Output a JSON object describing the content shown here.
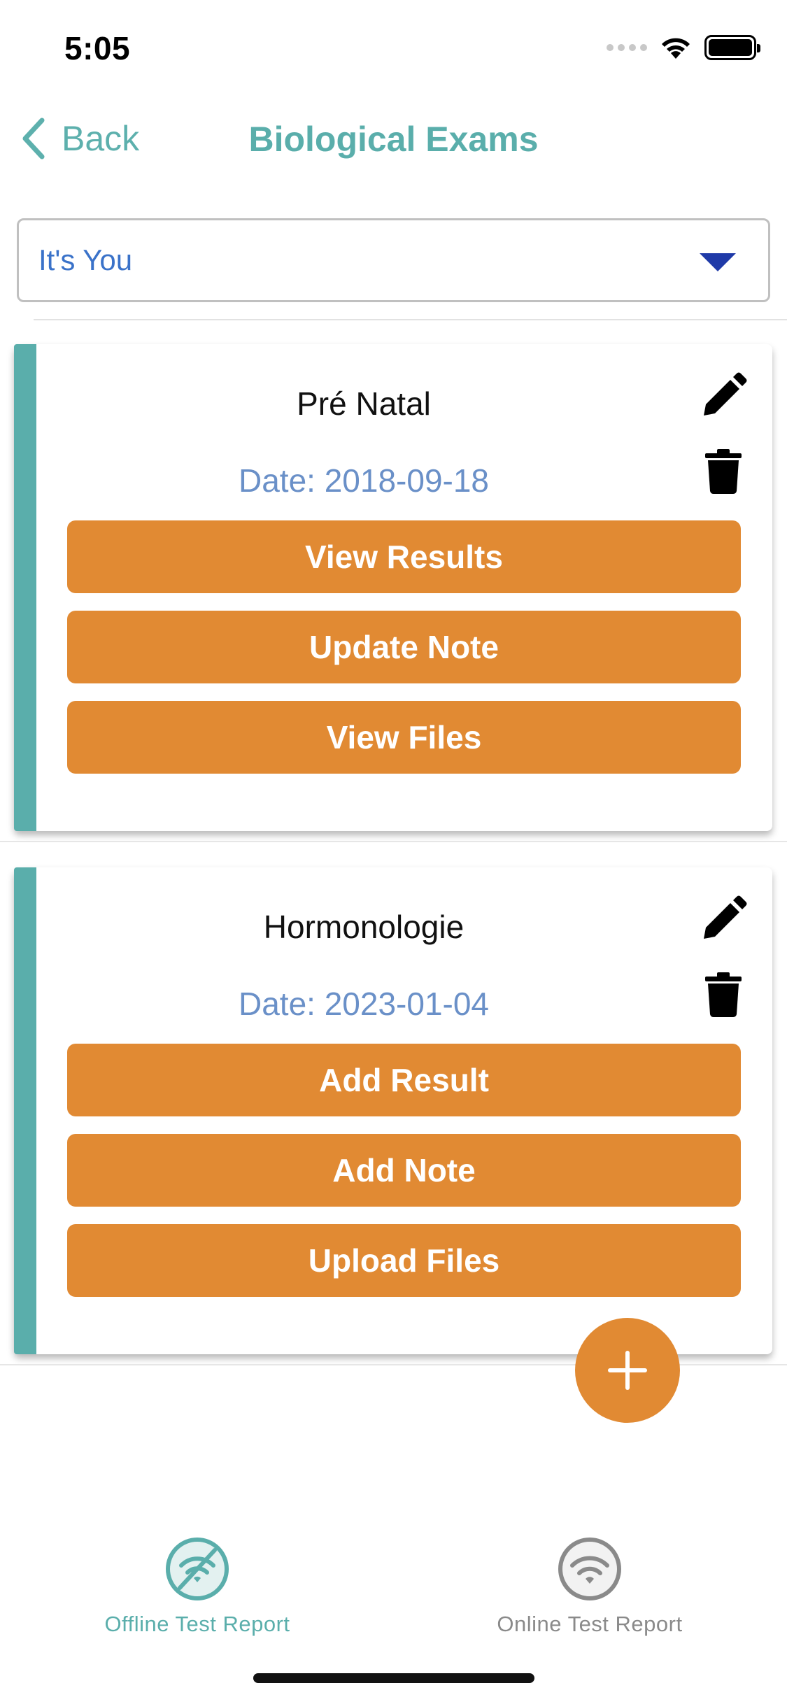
{
  "status_bar": {
    "time": "5:05"
  },
  "nav": {
    "back_label": "Back",
    "title": "Biological Exams"
  },
  "selector": {
    "value": "It's You"
  },
  "exams": [
    {
      "title": "Pré Natal",
      "date": "Date: 2018-09-18",
      "buttons": [
        "View Results",
        "Update Note",
        "View Files"
      ]
    },
    {
      "title": "Hormonologie",
      "date": "Date: 2023-01-04",
      "buttons": [
        "Add Result",
        "Add Note",
        "Upload Files"
      ]
    }
  ],
  "tabs": [
    {
      "label": "Offline Test Report",
      "icon": "wifi-off-icon",
      "active": true
    },
    {
      "label": "Online Test Report",
      "icon": "wifi-icon",
      "active": false
    }
  ],
  "colors": {
    "accent": "#5aaeab",
    "button": "#e18a33",
    "date_text": "#6a90c8",
    "selector_text": "#3a72c9"
  }
}
